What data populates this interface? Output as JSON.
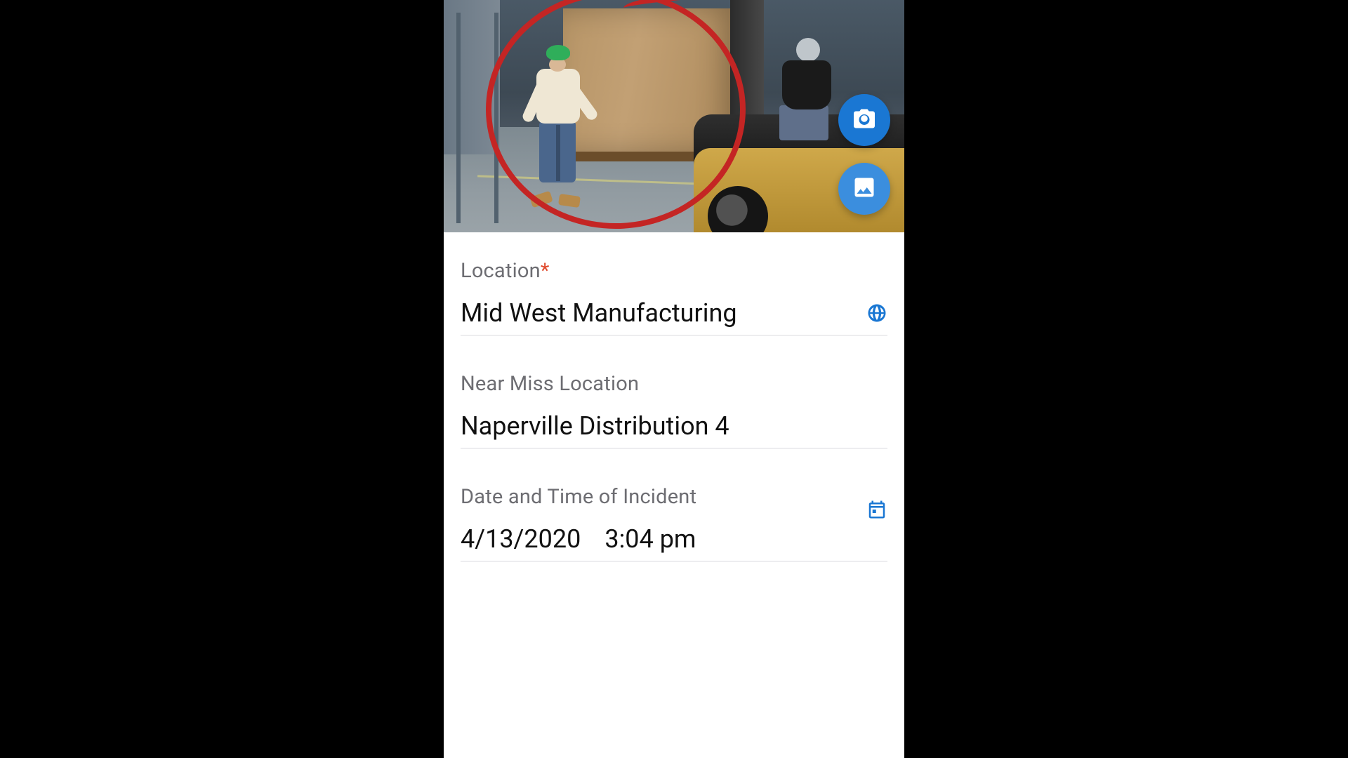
{
  "icons": {
    "camera": "camera-icon",
    "gallery": "image-icon",
    "globe": "globe-icon",
    "calendar": "calendar-icon"
  },
  "fields": {
    "location": {
      "label": "Location",
      "required_mark": "*",
      "value": "Mid West Manufacturing"
    },
    "near_miss_location": {
      "label": "Near Miss Location",
      "value": "Naperville Distribution 4"
    },
    "datetime": {
      "label": "Date and Time of Incident",
      "date": "4/13/2020",
      "time": "3:04 pm"
    }
  }
}
